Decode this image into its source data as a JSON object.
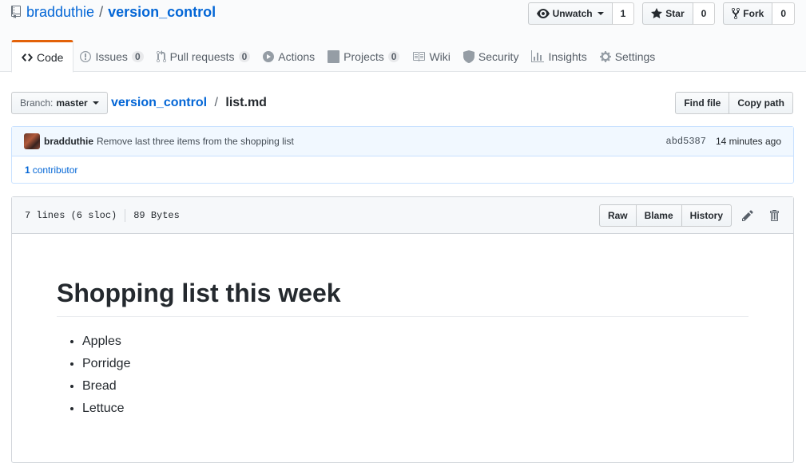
{
  "repo": {
    "owner": "bradduthie",
    "separator": "/",
    "name": "version_control"
  },
  "actions": {
    "watch": {
      "label": "Unwatch",
      "count": "1"
    },
    "star": {
      "label": "Star",
      "count": "0"
    },
    "fork": {
      "label": "Fork",
      "count": "0"
    }
  },
  "tabs": [
    {
      "label": "Code",
      "icon": "code-icon"
    },
    {
      "label": "Issues",
      "count": "0",
      "icon": "issue-icon"
    },
    {
      "label": "Pull requests",
      "count": "0",
      "icon": "pull-request-icon"
    },
    {
      "label": "Actions",
      "icon": "play-icon"
    },
    {
      "label": "Projects",
      "count": "0",
      "icon": "project-icon"
    },
    {
      "label": "Wiki",
      "icon": "book-icon"
    },
    {
      "label": "Security",
      "icon": "shield-icon"
    },
    {
      "label": "Insights",
      "icon": "graph-icon"
    },
    {
      "label": "Settings",
      "icon": "gear-icon"
    }
  ],
  "branch": {
    "label": "Branch:",
    "value": "master"
  },
  "breadcrumb": {
    "root": "version_control",
    "separator": "/",
    "file": "list.md"
  },
  "file_buttons": {
    "find": "Find file",
    "copy": "Copy path"
  },
  "commit": {
    "author": "bradduthie",
    "message": "Remove last three items from the shopping list",
    "sha": "abd5387",
    "time": "14 minutes ago",
    "contributors_count": "1",
    "contributors_label": "contributor"
  },
  "file": {
    "lines": "7 lines (6 sloc)",
    "size": "89 Bytes",
    "raw": "Raw",
    "blame": "Blame",
    "history": "History"
  },
  "markdown": {
    "heading": "Shopping list this week",
    "items": [
      "Apples",
      "Porridge",
      "Bread",
      "Lettuce"
    ]
  },
  "colors": {
    "link": "#0366d6",
    "selected_tab_accent": "#e36209",
    "commit_bg": "#f1f8ff"
  }
}
